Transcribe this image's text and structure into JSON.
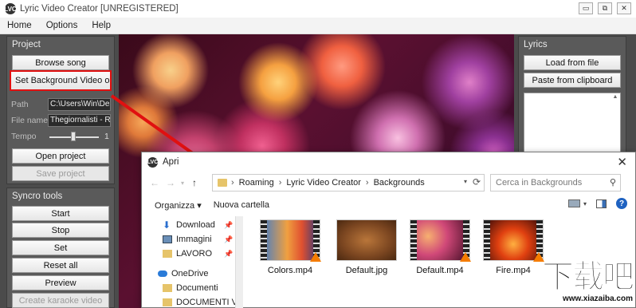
{
  "window": {
    "title": "Lyric Video Creator [UNREGISTERED]",
    "app_icon": "LVC",
    "minimize": "▭",
    "restore": "⧉",
    "close": "✕"
  },
  "menu": [
    "Home",
    "Options",
    "Help"
  ],
  "project": {
    "title": "Project",
    "browse_song": "Browse song",
    "set_background": "Set Background Video o...",
    "path_label": "Path",
    "path_value": "C:\\Users\\Win\\Deskt",
    "filename_label": "File name",
    "filename_value": "Thegiornalisti - Ricc",
    "tempo_label": "Tempo",
    "tempo_value": "1",
    "open_project": "Open project",
    "save_project": "Save project"
  },
  "syncro": {
    "title": "Syncro tools",
    "start": "Start",
    "stop": "Stop",
    "set": "Set",
    "reset_all": "Reset all",
    "preview": "Preview",
    "create_karaoke": "Create karaoke video"
  },
  "lyrics": {
    "title": "Lyrics",
    "load_from_file": "Load from file",
    "paste_from_clipboard": "Paste from clipboard"
  },
  "dialog": {
    "title": "Apri",
    "close": "✕",
    "breadcrumb": [
      "Roaming",
      "Lyric Video Creator",
      "Backgrounds"
    ],
    "search_placeholder": "Cerca in Backgrounds",
    "organize": "Organizza ▾",
    "new_folder": "Nuova cartella",
    "nav": [
      {
        "label": "Download",
        "icon": "download-icon",
        "pinned": true
      },
      {
        "label": "Immagini",
        "icon": "images-icon",
        "pinned": true
      },
      {
        "label": "LAVORO",
        "icon": "folder-icon",
        "pinned": true
      },
      {
        "label": "OneDrive",
        "icon": "cloud-icon",
        "pinned": false
      },
      {
        "label": "Documenti",
        "icon": "folder-icon",
        "pinned": false
      },
      {
        "label": "DOCUMENTI VA",
        "icon": "folder-icon",
        "pinned": false
      }
    ],
    "files": [
      {
        "name": "Colors.mp4",
        "type": "video"
      },
      {
        "name": "Default.jpg",
        "type": "image"
      },
      {
        "name": "Default.mp4",
        "type": "video"
      },
      {
        "name": "Fire.mp4",
        "type": "video"
      }
    ]
  },
  "watermark": {
    "chars": "下载吧",
    "url": "www.xiazaiba.com"
  },
  "colors": {
    "highlight": "#e01010",
    "panel_bg": "#5a5a5a",
    "help_blue": "#1f62c1"
  }
}
